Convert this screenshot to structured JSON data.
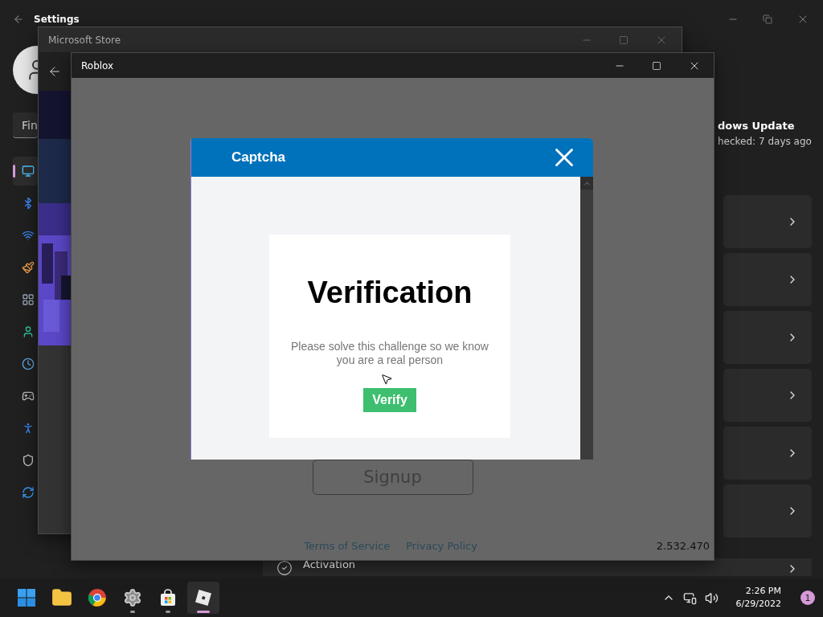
{
  "settings": {
    "title": "Settings",
    "search": {
      "placeholder": "Fin"
    },
    "nav_items": [
      {
        "kind": "display",
        "selected": true
      },
      {
        "kind": "bluetooth",
        "selected": false
      },
      {
        "kind": "network",
        "selected": false
      },
      {
        "kind": "personalization",
        "selected": false
      },
      {
        "kind": "apps",
        "selected": false
      },
      {
        "kind": "accounts",
        "selected": false
      },
      {
        "kind": "time",
        "selected": false
      },
      {
        "kind": "gaming",
        "selected": false
      },
      {
        "kind": "accessibility",
        "selected": false
      },
      {
        "kind": "privacy",
        "selected": false
      },
      {
        "kind": "update",
        "selected": false
      }
    ],
    "header": {
      "title": "dows Update",
      "subtitle": "hecked: 7 days ago"
    },
    "cards": [
      {
        "kind": "blank"
      },
      {
        "kind": "blank"
      },
      {
        "kind": "blank"
      },
      {
        "kind": "blank"
      },
      {
        "kind": "blank"
      },
      {
        "kind": "blank"
      },
      {
        "kind": "item",
        "title": "Activation"
      }
    ]
  },
  "store_window": {
    "title": "Microsoft Store"
  },
  "roblox_window": {
    "title": "Roblox",
    "signup": "Signup",
    "links": [
      "Terms of Service",
      "Privacy Policy"
    ],
    "version": "2.532.470"
  },
  "captcha": {
    "title": "Captcha",
    "heading": "Verification",
    "message": "Please solve this challenge so we know you are a real person",
    "button": "Verify"
  },
  "taskbar": {
    "apps": [
      {
        "kind": "start",
        "running": false,
        "active": false
      },
      {
        "kind": "explorer",
        "running": false,
        "active": false
      },
      {
        "kind": "chrome",
        "running": false,
        "active": false
      },
      {
        "kind": "settings",
        "running": true,
        "active": false
      },
      {
        "kind": "store",
        "running": true,
        "active": false
      },
      {
        "kind": "roblox",
        "running": true,
        "active": true
      }
    ],
    "time": "2:26 PM",
    "date": "6/29/2022",
    "notifications": "1"
  }
}
